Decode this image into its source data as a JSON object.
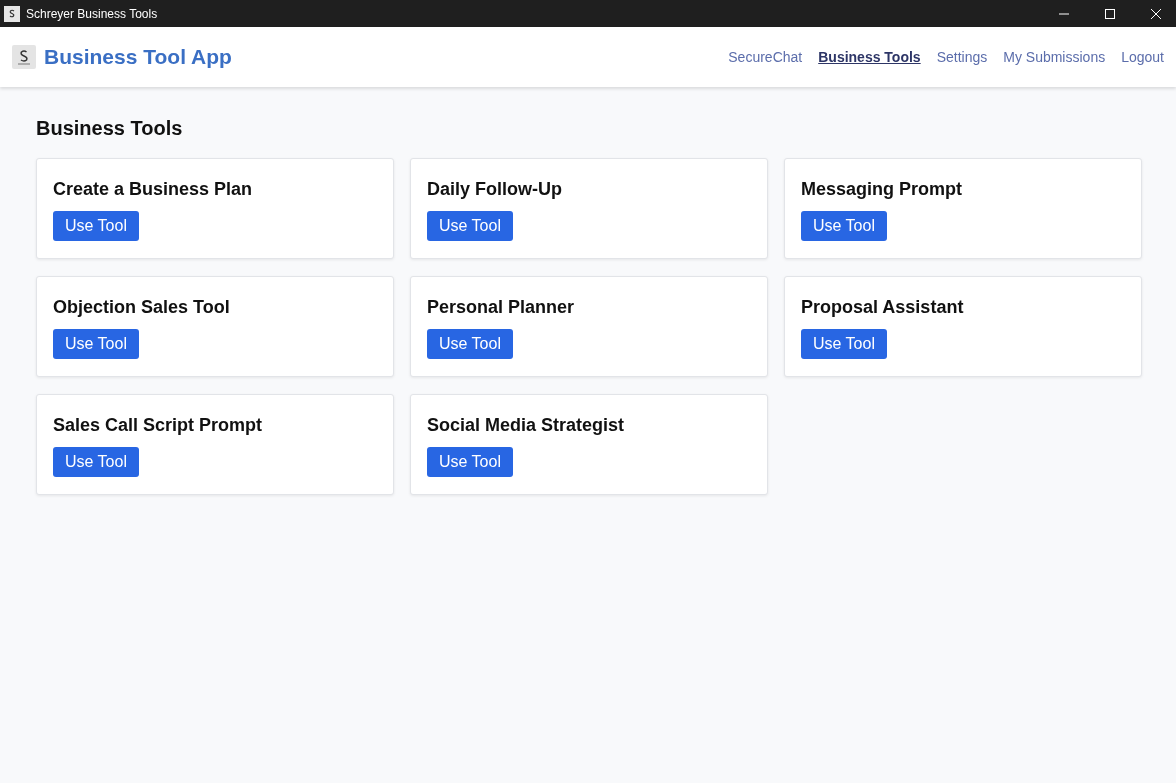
{
  "window": {
    "title": "Schreyer Business Tools"
  },
  "header": {
    "app_name": "Business Tool App",
    "nav": [
      {
        "label": "SecureChat",
        "selected": false
      },
      {
        "label": "Business Tools",
        "selected": true
      },
      {
        "label": "Settings",
        "selected": false
      },
      {
        "label": "My Submissions",
        "selected": false
      },
      {
        "label": "Logout",
        "selected": false
      }
    ]
  },
  "main": {
    "heading": "Business Tools",
    "tools": [
      {
        "title": "Create a Business Plan",
        "button": "Use Tool"
      },
      {
        "title": "Daily Follow-Up",
        "button": "Use Tool"
      },
      {
        "title": "Messaging Prompt",
        "button": "Use Tool"
      },
      {
        "title": "Objection Sales Tool",
        "button": "Use Tool"
      },
      {
        "title": "Personal Planner",
        "button": "Use Tool"
      },
      {
        "title": "Proposal Assistant",
        "button": "Use Tool"
      },
      {
        "title": "Sales Call Script Prompt",
        "button": "Use Tool"
      },
      {
        "title": "Social Media Strategist",
        "button": "Use Tool"
      }
    ]
  }
}
